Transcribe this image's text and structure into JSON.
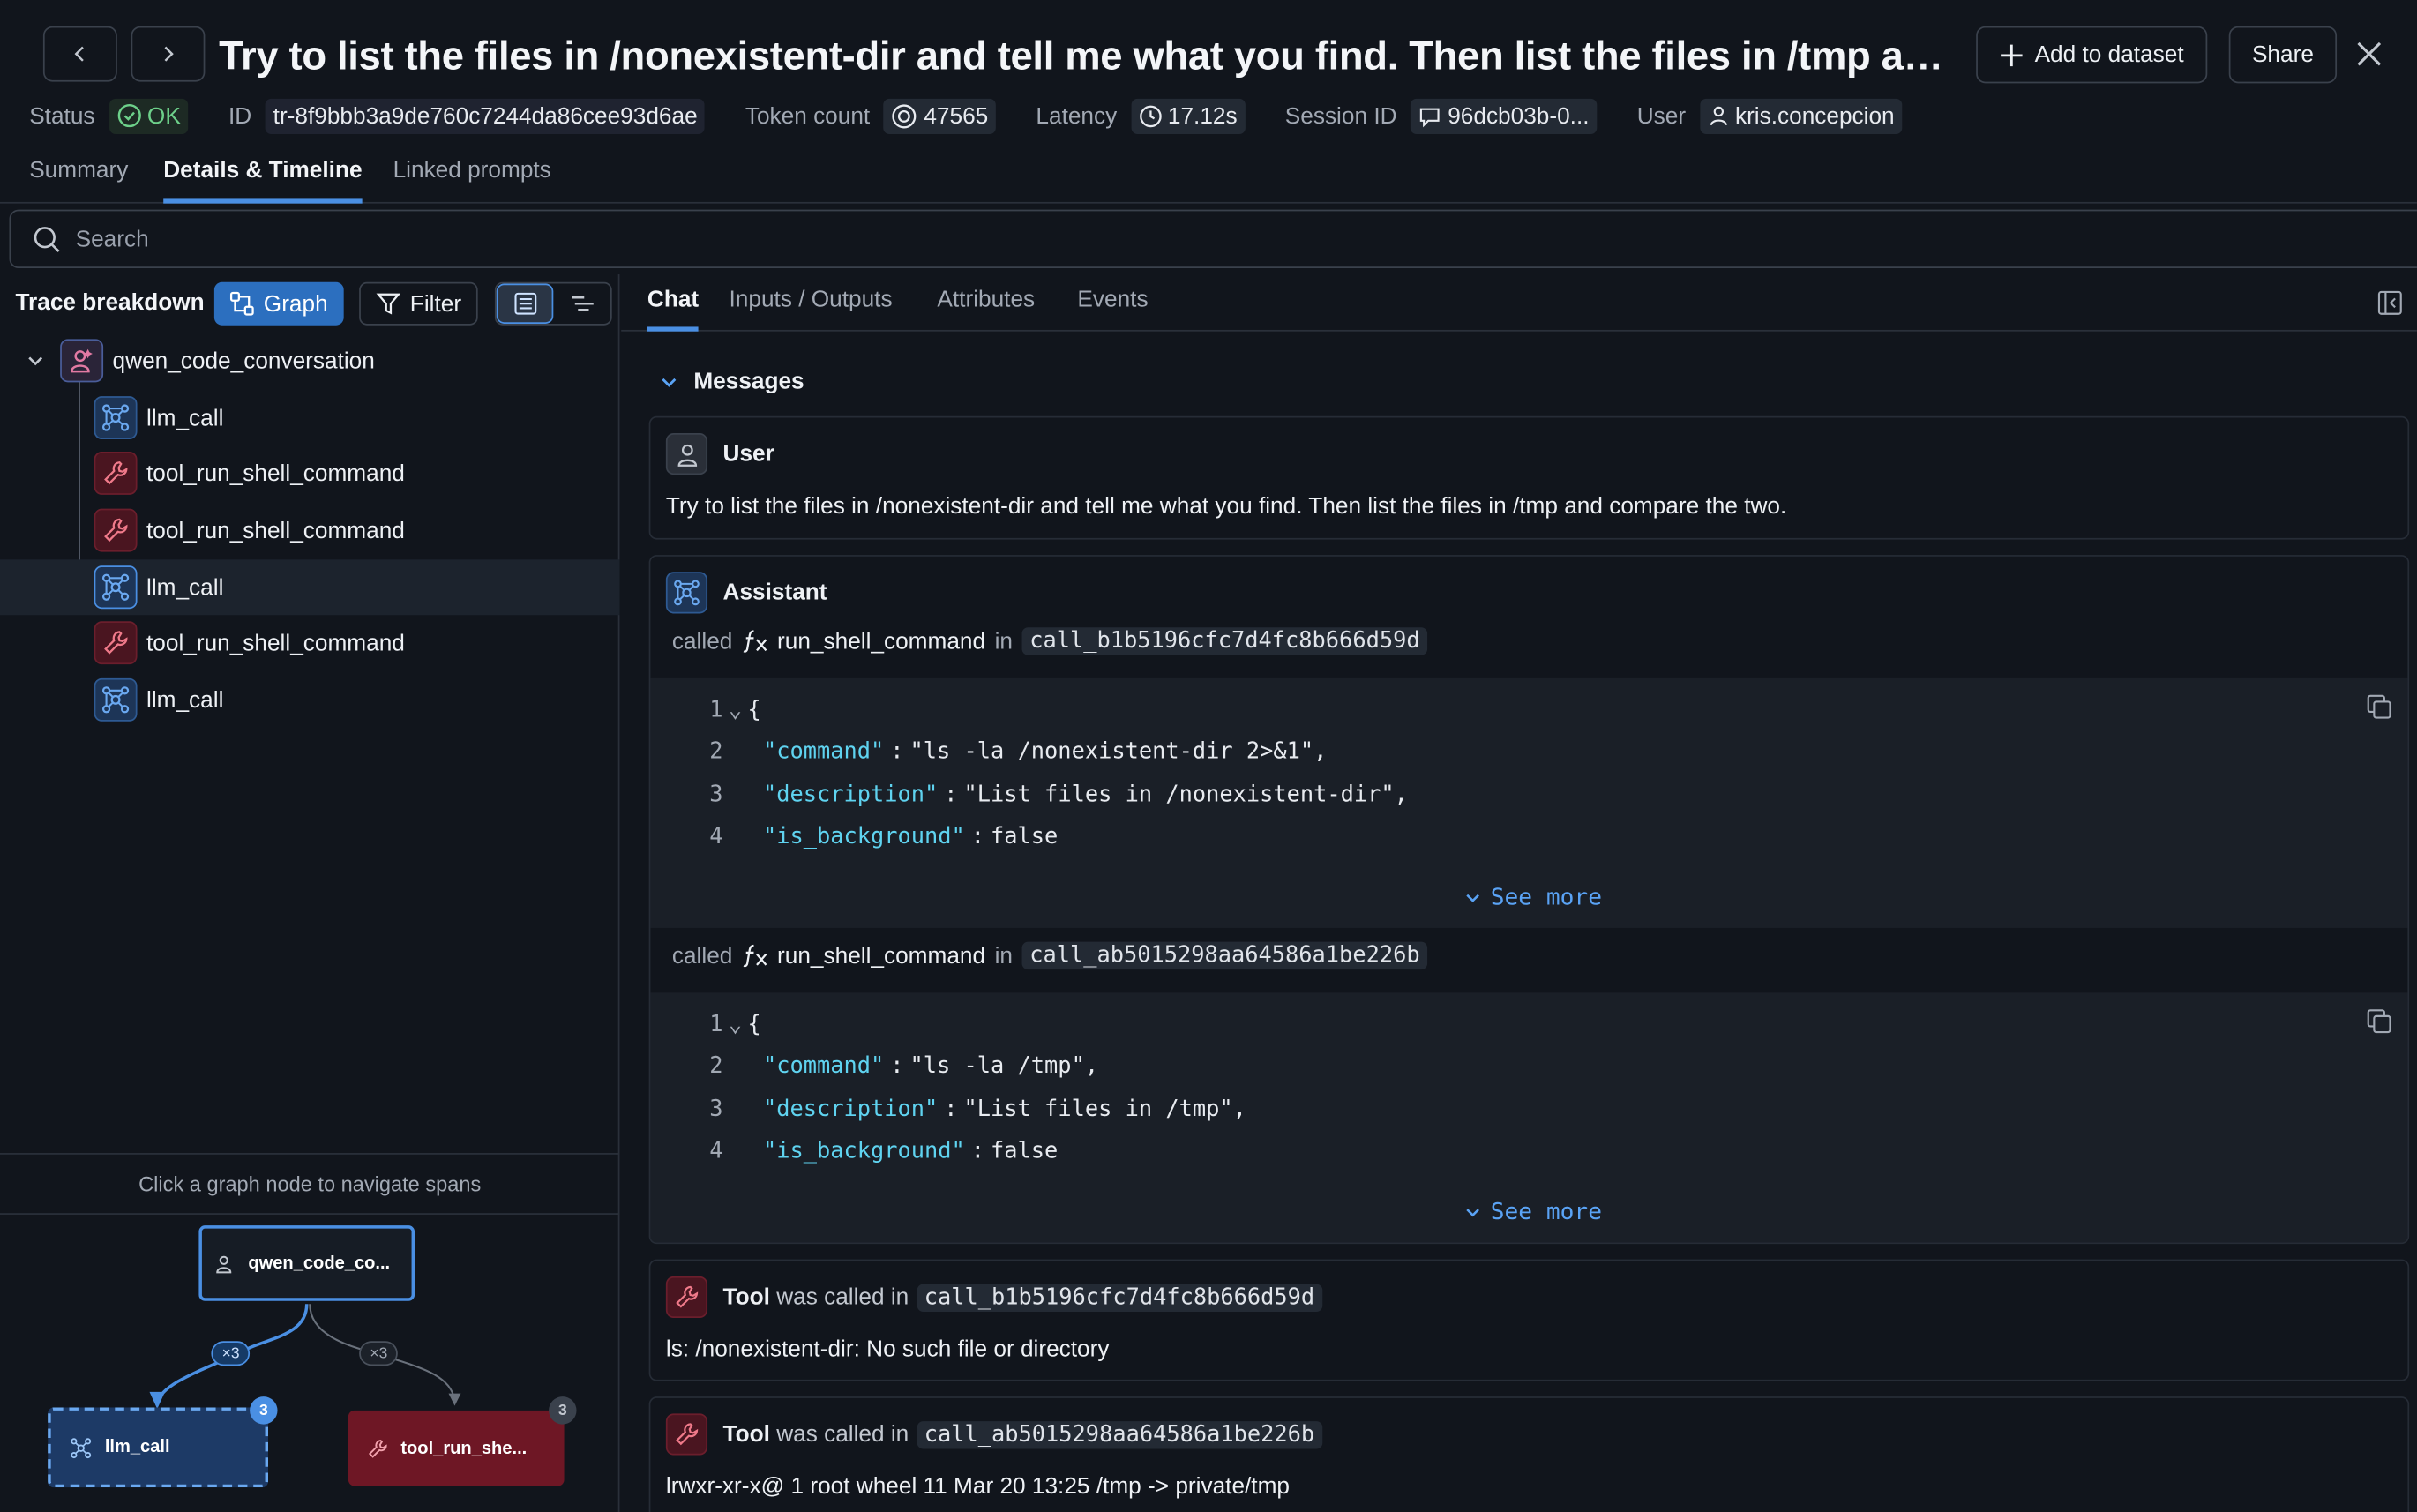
{
  "header": {
    "title": "Try to list the files in /nonexistent-dir and tell me what you find. Then list the files in /tmp and com...",
    "add_to_dataset": "Add to dataset",
    "share": "Share"
  },
  "meta": {
    "status_label": "Status",
    "status_value": "OK",
    "id_label": "ID",
    "id_value": "tr-8f9bbb3a9de760c7244da86cee93d6ae",
    "token_label": "Token count",
    "token_value": "47565",
    "latency_label": "Latency",
    "latency_value": "17.12s",
    "session_label": "Session ID",
    "session_value": "96dcb03b-0...",
    "user_label": "User",
    "user_value": "kris.concepcion"
  },
  "tabs": [
    "Summary",
    "Details & Timeline",
    "Linked prompts"
  ],
  "search": {
    "placeholder": "Search"
  },
  "left": {
    "title": "Trace breakdown",
    "graph_button": "Graph",
    "filter_button": "Filter",
    "tree": [
      {
        "label": "qwen_code_conversation",
        "kind": "root"
      },
      {
        "label": "llm_call",
        "kind": "llm"
      },
      {
        "label": "tool_run_shell_command",
        "kind": "tool"
      },
      {
        "label": "tool_run_shell_command",
        "kind": "tool"
      },
      {
        "label": "llm_call",
        "kind": "llm",
        "selected": true
      },
      {
        "label": "tool_run_shell_command",
        "kind": "tool"
      },
      {
        "label": "llm_call",
        "kind": "llm"
      }
    ],
    "graph_hint": "Click a graph node to navigate spans",
    "graph": {
      "root_node": "qwen_code_co...",
      "llm_node": "llm_call",
      "tool_node": "tool_run_she...",
      "llm_edge": "×3",
      "tool_edge": "×3",
      "llm_badge": "3",
      "tool_badge": "3"
    }
  },
  "right": {
    "tabs": [
      "Chat",
      "Inputs / Outputs",
      "Attributes",
      "Events"
    ],
    "messages_header": "Messages",
    "user": {
      "role": "User",
      "text": "Try to list the files in /nonexistent-dir and tell me what you find. Then list the files in /tmp and compare the two."
    },
    "assistant": {
      "role": "Assistant",
      "called_word": "called",
      "in_word": "in",
      "see_more": "See more",
      "calls": [
        {
          "function": "run_shell_command",
          "call_id": "call_b1b5196cfc7d4fc8b666d59d",
          "lines": [
            {
              "n": "1",
              "text": "{"
            },
            {
              "n": "2",
              "key": "\"command\"",
              "value": "\"ls -la /nonexistent-dir 2>&1\","
            },
            {
              "n": "3",
              "key": "\"description\"",
              "value": "\"List files in /nonexistent-dir\","
            },
            {
              "n": "4",
              "key": "\"is_background\"",
              "value": "false"
            }
          ]
        },
        {
          "function": "run_shell_command",
          "call_id": "call_ab5015298aa64586a1be226b",
          "lines": [
            {
              "n": "1",
              "text": "{"
            },
            {
              "n": "2",
              "key": "\"command\"",
              "value": "\"ls -la /tmp\","
            },
            {
              "n": "3",
              "key": "\"description\"",
              "value": "\"List files in /tmp\","
            },
            {
              "n": "4",
              "key": "\"is_background\"",
              "value": "false"
            }
          ]
        }
      ]
    },
    "tools": [
      {
        "role": "Tool",
        "phrase": "was called in",
        "call_id": "call_b1b5196cfc7d4fc8b666d59d",
        "output": "ls: /nonexistent-dir: No such file or directory"
      },
      {
        "role": "Tool",
        "phrase": "was called in",
        "call_id": "call_ab5015298aa64586a1be226b",
        "output": "lrwxr-xr-x@ 1 root wheel 11 Mar 20 13:25 /tmp -> private/tmp"
      }
    ]
  },
  "colors": {
    "accent": "#4a8fe3",
    "ok": "#6dd08a",
    "llm": "#1d3557",
    "tool": "#4a1520",
    "json_key": "#5fd3f0"
  }
}
